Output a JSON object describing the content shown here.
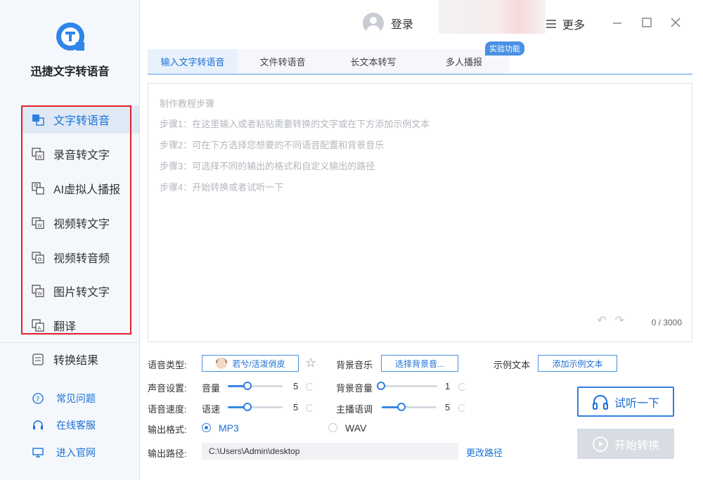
{
  "app": {
    "name": "迅捷文字转语音"
  },
  "colors": {
    "accent": "#2f7fe0",
    "highlight_border": "#e0202b",
    "sidebar_bg": "#f4f8fc"
  },
  "topbar": {
    "login": "登录",
    "more": "更多"
  },
  "sidebar": {
    "items": [
      {
        "label": "文字转语音",
        "icon": "text-to-speech-icon"
      },
      {
        "label": "录音转文字",
        "icon": "recording-to-text-icon"
      },
      {
        "label": "AI虚拟人播报",
        "icon": "ai-avatar-icon"
      },
      {
        "label": "视频转文字",
        "icon": "video-to-text-icon"
      },
      {
        "label": "视频转音频",
        "icon": "video-to-audio-icon"
      },
      {
        "label": "图片转文字",
        "icon": "image-to-text-icon"
      },
      {
        "label": "翻译",
        "icon": "translate-icon"
      }
    ],
    "result": "转换结果",
    "bottom": [
      {
        "label": "常见问题",
        "icon": "question-icon"
      },
      {
        "label": "在线客服",
        "icon": "headset-icon"
      },
      {
        "label": "进入官网",
        "icon": "monitor-icon"
      }
    ]
  },
  "tabs": [
    {
      "label": "输入文字转语音"
    },
    {
      "label": "文件转语音"
    },
    {
      "label": "长文本转写"
    },
    {
      "label": "多人播报"
    }
  ],
  "badge": "实验功能",
  "editor": {
    "lines": [
      "制作教程步骤",
      "步骤1：在这里输入或者粘贴需要转换的文字或在下方添加示例文本",
      "步骤2：可在下方选择您想要的不同语音配置和背景音乐",
      "步骤3：可选择不同的输出的格式和自定义输出的路径",
      "步骤4：开始转换或者试听一下"
    ],
    "counter": "0 / 3000"
  },
  "settings": {
    "voice_type_label": "语音类型:",
    "voice_name": "若兮/活泼俏皮",
    "bg_music_label": "背景音乐",
    "bg_music_button": "选择背景音...",
    "sample_label": "示例文本",
    "sample_button": "添加示例文本",
    "sound_label": "声音设置:",
    "volume_label": "音量",
    "volume_value": "5",
    "volume_level": 0.33,
    "bg_volume_label": "背景音量",
    "bg_volume_value": "1",
    "bg_volume_level": 0,
    "speed_label": "语音速度:",
    "speed_sub": "语速",
    "speed_value": "5",
    "speed_level": 0.33,
    "pitch_label": "主播语调",
    "pitch_value": "5",
    "pitch_level": 0.33,
    "format_label": "输出格式:",
    "format_mp3": "MP3",
    "format_wav": "WAV",
    "path_label": "输出路径:",
    "path_value": "C:\\Users\\Admin\\desktop",
    "change_path": "更改路径"
  },
  "actions": {
    "listen": "试听一下",
    "convert": "开始转换"
  }
}
